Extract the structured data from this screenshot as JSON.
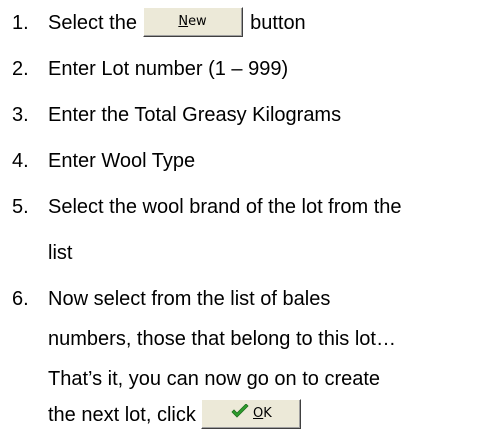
{
  "steps": [
    {
      "num": "1.",
      "before": "Select the",
      "button_mnemonic": "N",
      "button_rest": "ew",
      "after": "button"
    },
    {
      "num": "2.",
      "text": "Enter Lot number (1 – 999)"
    },
    {
      "num": "3.",
      "text": "Enter the Total Greasy Kilograms"
    },
    {
      "num": "4.",
      "text": "Enter Wool Type"
    },
    {
      "num": "5.",
      "lines": [
        "Select the wool brand of the lot from the",
        "list"
      ]
    },
    {
      "num": "6.",
      "lines": [
        "Now select from the list of bales",
        "numbers, those that belong to this lot…",
        "That’s it, you can now go on to create"
      ]
    }
  ],
  "final_line": {
    "text": "the next lot, click",
    "ok_mnemonic": "O",
    "ok_rest": "K",
    "ok_icon": "checkmark-icon"
  },
  "colors": {
    "button_face": "#ece9d8",
    "check_green": "#2e9e2e"
  }
}
